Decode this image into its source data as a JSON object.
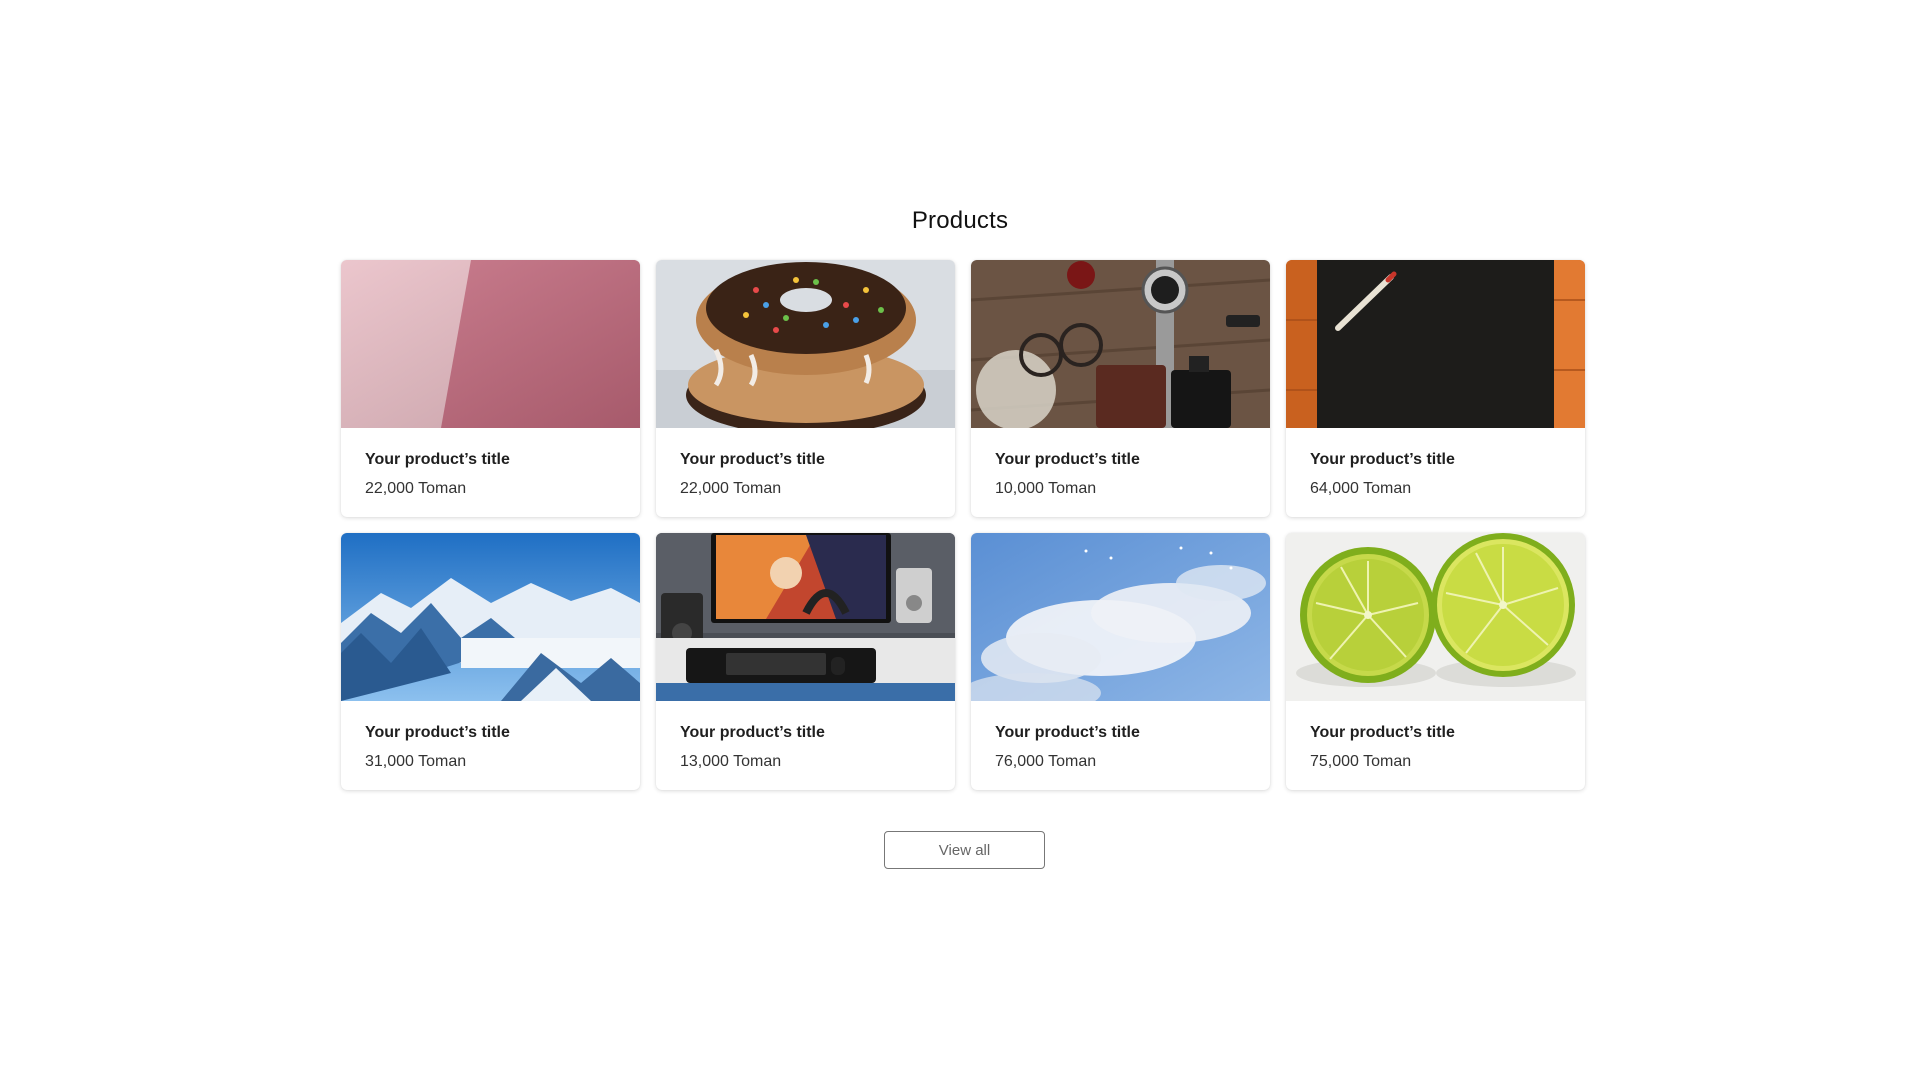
{
  "section": {
    "title": "Products"
  },
  "products": [
    {
      "title": "Your product’s title",
      "price": "22,000 Toman",
      "image_icon": "pink-wall-image"
    },
    {
      "title": "Your product’s title",
      "price": "22,000 Toman",
      "image_icon": "donuts-image"
    },
    {
      "title": "Your product’s title",
      "price": "10,000 Toman",
      "image_icon": "watch-glasses-image"
    },
    {
      "title": "Your product’s title",
      "price": "64,000 Toman",
      "image_icon": "pencil-blackboard-image"
    },
    {
      "title": "Your product’s title",
      "price": "31,000 Toman",
      "image_icon": "mountains-image"
    },
    {
      "title": "Your product’s title",
      "price": "13,000 Toman",
      "image_icon": "gaming-setup-image"
    },
    {
      "title": "Your product’s title",
      "price": "76,000 Toman",
      "image_icon": "sky-clouds-image"
    },
    {
      "title": "Your product’s title",
      "price": "75,000 Toman",
      "image_icon": "limes-image"
    }
  ],
  "actions": {
    "view_all_label": "View all"
  }
}
